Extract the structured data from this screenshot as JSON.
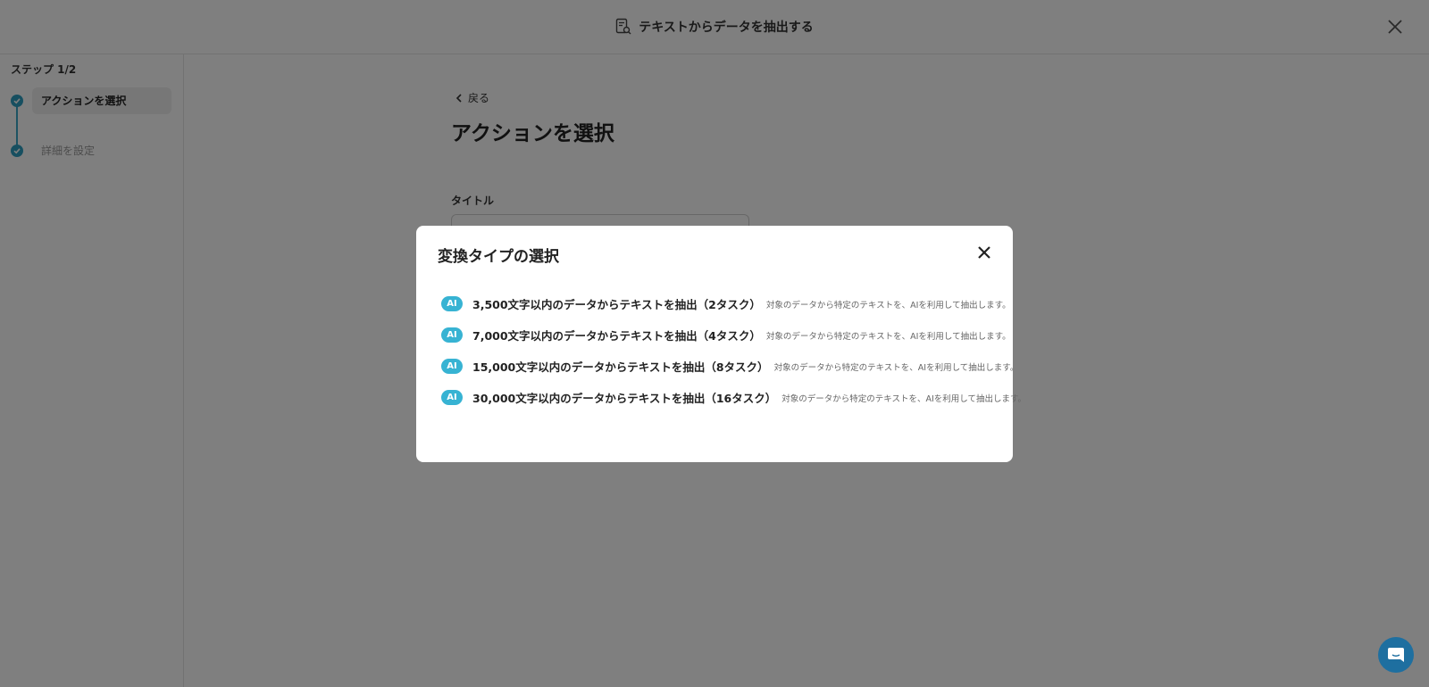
{
  "header": {
    "title": "テキストからデータを抽出する",
    "icon": "document-search-icon",
    "close_icon": "close-icon"
  },
  "sidebar": {
    "step_indicator": "ステップ 1/2",
    "steps": [
      {
        "label": "アクションを選択",
        "state": "active"
      },
      {
        "label": "詳細を設定",
        "state": "inactive"
      }
    ]
  },
  "main": {
    "back_label": "戻る",
    "page_title": "アクションを選択",
    "title_field_label": "タイトル",
    "title_field_value": ""
  },
  "modal": {
    "title": "変換タイプの選択",
    "options": [
      {
        "badge": "AI",
        "label": "3,500文字以内のデータからテキストを抽出（2タスク）",
        "description": "対象のデータから特定のテキストを、AIを利用して抽出します。"
      },
      {
        "badge": "AI",
        "label": "7,000文字以内のデータからテキストを抽出（4タスク）",
        "description": "対象のデータから特定のテキストを、AIを利用して抽出します。"
      },
      {
        "badge": "AI",
        "label": "15,000文字以内のデータからテキストを抽出（8タスク）",
        "description": "対象のデータから特定のテキストを、AIを利用して抽出します。"
      },
      {
        "badge": "AI",
        "label": "30,000文字以内のデータからテキストを抽出（16タスク）",
        "description": "対象のデータから特定のテキストを、AIを利用して抽出します。"
      }
    ]
  },
  "colors": {
    "accent": "#37b3d3",
    "step_done": "#2f9fc1",
    "chat_button": "#1e6fa0",
    "overlay": "rgba(0,0,0,0.5)"
  }
}
